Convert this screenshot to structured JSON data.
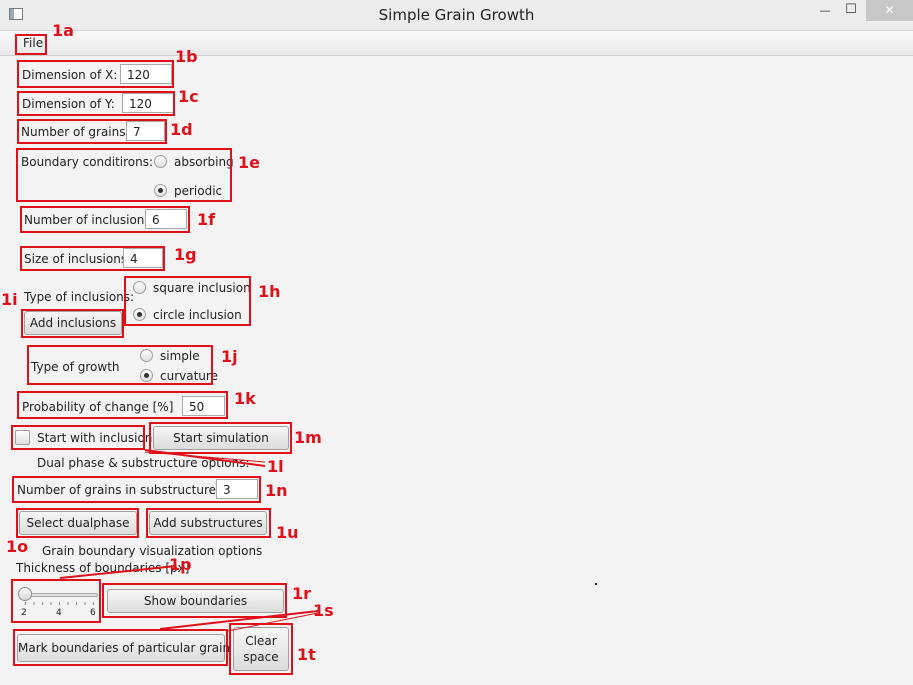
{
  "window": {
    "title": "Simple Grain Growth",
    "minimize": "—",
    "maximize": "☐",
    "close": "✕"
  },
  "menu": {
    "file": "File"
  },
  "form": {
    "dim_x_label": "Dimension of X:",
    "dim_x_value": "120",
    "dim_y_label": "Dimension of Y:",
    "dim_y_value": "120",
    "grains_label": "Number of grains:",
    "grains_value": "7",
    "boundary_label": "Boundary conditirons:",
    "boundary_absorbing": "absorbing",
    "boundary_periodic": "periodic",
    "inclusions_count_label": "Number of inclusions",
    "inclusions_count_value": "6",
    "inclusions_size_label": "Size of inclusions",
    "inclusions_size_value": "4",
    "inclusion_type_label": "Type of inclusions:",
    "add_inclusions": "Add inclusions",
    "square_inclusion": "square inclusion",
    "circle_inclusion": "circle inclusion",
    "growth_type_label": "Type of growth",
    "growth_simple": "simple",
    "growth_curvature": "curvature",
    "probability_label": "Probability of change [%]",
    "probability_value": "50",
    "start_with_inclusions": "Start with inclusions",
    "start_simulation": "Start simulation",
    "dual_phase_header": "Dual phase & substructure options:",
    "substructure_grains_label": "Number of grains in substructures:",
    "substructure_grains_value": "3",
    "select_dualphase": "Select dualphase",
    "add_substructures": "Add substructures",
    "gb_header": "Grain boundary visualization options",
    "thickness_label": "Thickness of boundaries [px]",
    "slider_ticks": [
      "2",
      "4",
      "6"
    ],
    "slider_value": 2,
    "show_boundaries": "Show boundaries",
    "mark_boundaries": "Mark boundaries of particular grain",
    "clear_space_line1": "Clear",
    "clear_space_line2": "space"
  },
  "annotations": {
    "a1a": "1a",
    "a1b": "1b",
    "a1c": "1c",
    "a1d": "1d",
    "a1e": "1e",
    "a1f": "1f",
    "a1g": "1g",
    "a1h": "1h",
    "a1i": "1i",
    "a1j": "1j",
    "a1k": "1k",
    "a1l": "1l",
    "a1m": "1m",
    "a1n": "1n",
    "a1o": "1o",
    "a1p": "1p",
    "a1r": "1r",
    "a1s": "1s",
    "a1t": "1t",
    "a1u": "1u"
  },
  "colors": {
    "annotation": "#e0101a",
    "window_bg": "#f3f3f3"
  }
}
